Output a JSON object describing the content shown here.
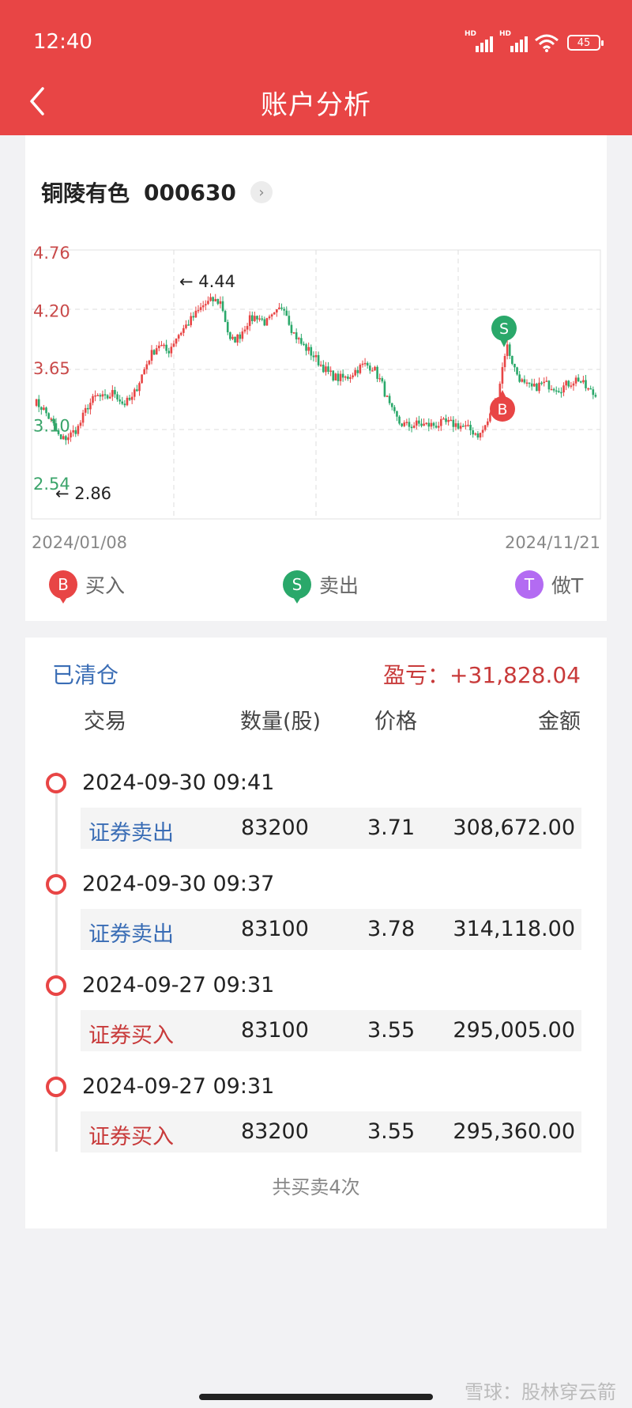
{
  "status_bar": {
    "time": "12:40",
    "battery": "45"
  },
  "header": {
    "title": "账户分析"
  },
  "stock": {
    "name": "铜陵有色",
    "code": "000630"
  },
  "chart_data": {
    "type": "candlestick",
    "y_ticks": [
      "4.76",
      "4.20",
      "3.65",
      "3.10",
      "2.54"
    ],
    "ylim": [
      2.54,
      4.76
    ],
    "x_start_label": "2024/01/08",
    "x_end_label": "2024/11/21",
    "high_marker": "4.44",
    "low_marker": "2.86",
    "colors": {
      "up": "#e84545",
      "down": "#2aa86a",
      "grid": "#dcdcdc",
      "tick_up": "#c94a4a",
      "tick_down": "#3aa46a"
    },
    "close_path": [
      3.33,
      3.26,
      3.13,
      2.95,
      3.0,
      3.08,
      3.28,
      3.38,
      3.35,
      3.42,
      3.3,
      3.35,
      3.56,
      3.76,
      3.88,
      3.8,
      3.95,
      4.05,
      4.15,
      4.25,
      4.3,
      4.28,
      3.9,
      3.95,
      4.1,
      4.15,
      4.08,
      4.15,
      4.26,
      4.0,
      3.88,
      3.8,
      3.7,
      3.6,
      3.55,
      3.55,
      3.62,
      3.68,
      3.66,
      3.5,
      3.25,
      3.12,
      3.09,
      3.11,
      3.1,
      3.1,
      3.12,
      3.11,
      3.09,
      3.05,
      3.0,
      3.15,
      3.38,
      3.88,
      3.62,
      3.48,
      3.45,
      3.5,
      3.48,
      3.45,
      3.5,
      3.55,
      3.45,
      3.38
    ],
    "markers": [
      {
        "type": "S",
        "label": "S",
        "price": 3.9
      },
      {
        "type": "B",
        "label": "B",
        "price": 3.35
      }
    ]
  },
  "legend": {
    "buy": "买入",
    "sell": "卖出",
    "t": "做T",
    "buy_icon": "B",
    "sell_icon": "S",
    "t_icon": "T"
  },
  "summary": {
    "status": "已清仓",
    "pnl": "盈亏：+31,828.04",
    "columns": [
      "交易",
      "数量(股)",
      "价格",
      "金额"
    ]
  },
  "transactions": [
    {
      "time": "2024-09-30 09:41",
      "type": "证券卖出",
      "qty": "83200",
      "price": "3.71",
      "amount": "308,672.00"
    },
    {
      "time": "2024-09-30 09:37",
      "type": "证券卖出",
      "qty": "83100",
      "price": "3.78",
      "amount": "314,118.00"
    },
    {
      "time": "2024-09-27 09:31",
      "type": "证券买入",
      "qty": "83100",
      "price": "3.55",
      "amount": "295,005.00"
    },
    {
      "time": "2024-09-27 09:31",
      "type": "证券买入",
      "qty": "83200",
      "price": "3.55",
      "amount": "295,360.00"
    }
  ],
  "footer": {
    "count_text": "共买卖4次"
  },
  "watermark": "雪球：股林穿云箭"
}
